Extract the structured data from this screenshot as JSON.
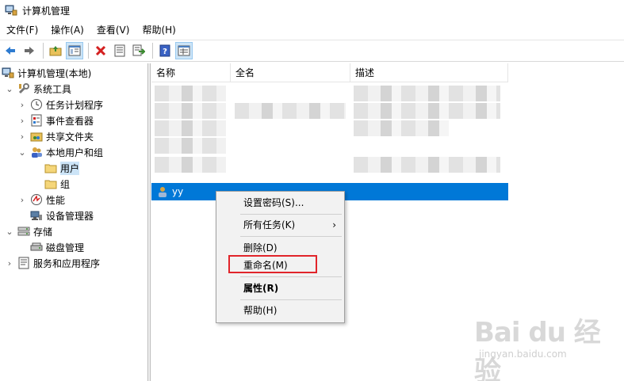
{
  "window": {
    "title": "计算机管理"
  },
  "menubar": {
    "items": [
      "文件(F)",
      "操作(A)",
      "查看(V)",
      "帮助(H)"
    ]
  },
  "toolbar": {
    "icons": [
      "back-arrow-icon",
      "forward-arrow-icon",
      "up-folder-icon",
      "show-hide-tree-icon",
      "delete-icon",
      "properties-icon",
      "export-list-icon",
      "help-icon",
      "details-view-icon"
    ]
  },
  "tree": {
    "root": "计算机管理(本地)",
    "system_tools": "系统工具",
    "task_scheduler": "任务计划程序",
    "event_viewer": "事件查看器",
    "shared_folders": "共享文件夹",
    "local_users_groups": "本地用户和组",
    "users": "用户",
    "groups": "组",
    "performance": "性能",
    "device_manager": "设备管理器",
    "storage": "存储",
    "disk_management": "磁盘管理",
    "services_apps": "服务和应用程序"
  },
  "list": {
    "columns": [
      "名称",
      "全名",
      "描述"
    ],
    "selected_user": "yy"
  },
  "context_menu": {
    "set_password": "设置密码(S)...",
    "all_tasks": "所有任务(K)",
    "delete": "删除(D)",
    "rename": "重命名(M)",
    "properties": "属性(R)",
    "help": "帮助(H)"
  },
  "colors": {
    "selection": "#0078d7",
    "highlight_box": "#e1242a"
  },
  "watermark": {
    "brand": "Bai du 经验",
    "url": "jingyan.baidu.com"
  }
}
